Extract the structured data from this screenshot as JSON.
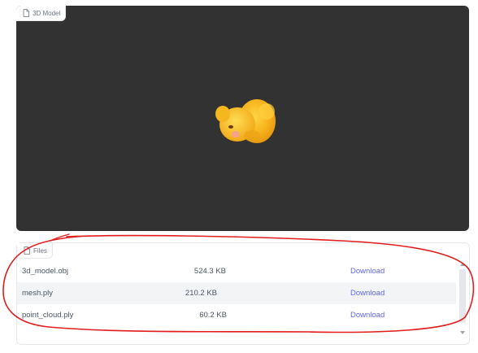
{
  "model_panel": {
    "label": "3D Model",
    "icon": "file-icon",
    "background_color": "#323232"
  },
  "files_panel": {
    "label": "Files",
    "icon": "file-icon",
    "rows": [
      {
        "name": "3d_model.obj",
        "size": "524.3 KB",
        "action": "Download"
      },
      {
        "name": "mesh.ply",
        "size": "210.2 KB",
        "action": "Download"
      },
      {
        "name": "point_cloud.ply",
        "size": "60.2 KB",
        "action": "Download"
      }
    ]
  },
  "colors": {
    "link": "#6366f1",
    "annotation": "#e11d1d",
    "model_fill": "#f5b21a"
  }
}
